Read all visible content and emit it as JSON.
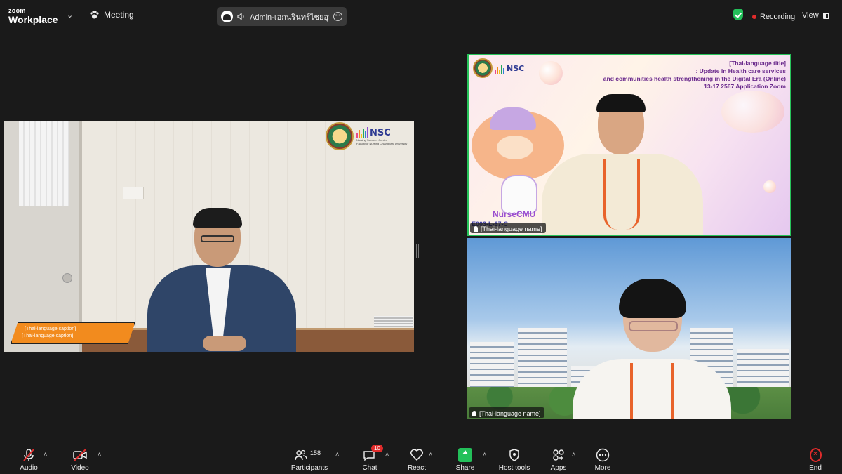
{
  "app": {
    "brand_top": "zoom",
    "brand_bottom": "Workplace"
  },
  "header": {
    "meeting_label": "Meeting",
    "share_label": "Admin-เอกนรินทร์ไชยอุมิ's scr",
    "recording_label": "Recording",
    "view_label": "View"
  },
  "logo": {
    "nsc": "NSC",
    "sub1": "Nursing Services Center",
    "sub2": "Faculty of Nursing Chiang Mai University"
  },
  "speaker": {
    "lower_third_line1": "[Thai-language caption]",
    "lower_third_line2": "[Thai-language caption]"
  },
  "tile_a": {
    "title_line1": "[Thai-language title]",
    "title_line2": ": Update in Health care services",
    "title_line3": "and communities health strengthening in the Digital Era (Online)",
    "title_line4": "13-17 2567 Application Zoom",
    "mascot_text": "NurseCMU",
    "course_code": "E003-L-67-C",
    "name_tag": "[Thai-language name]"
  },
  "tile_b": {
    "name_tag": "[Thai-language name]"
  },
  "toolbar": {
    "audio": "Audio",
    "video": "Video",
    "participants": "Participants",
    "participants_count": "158",
    "chat": "Chat",
    "chat_badge": "10",
    "react": "React",
    "share": "Share",
    "host_tools": "Host tools",
    "apps": "Apps",
    "more": "More",
    "end": "End"
  },
  "colors": {
    "active_speaker_border": "#27c35a",
    "recording_dot": "#e02b2b",
    "share_green": "#23c05a",
    "lower_third": "#f28b1e"
  },
  "icons": [
    "chevron-down-icon",
    "paw-icon",
    "speaker-icon",
    "more-icon",
    "shield-check-icon",
    "view-icon",
    "mic-off-icon",
    "video-off-icon",
    "participants-icon",
    "chat-icon",
    "heart-icon",
    "share-arrow-icon",
    "host-shield-icon",
    "apps-icon",
    "more-dots-icon",
    "end-icon",
    "pin-icon"
  ]
}
